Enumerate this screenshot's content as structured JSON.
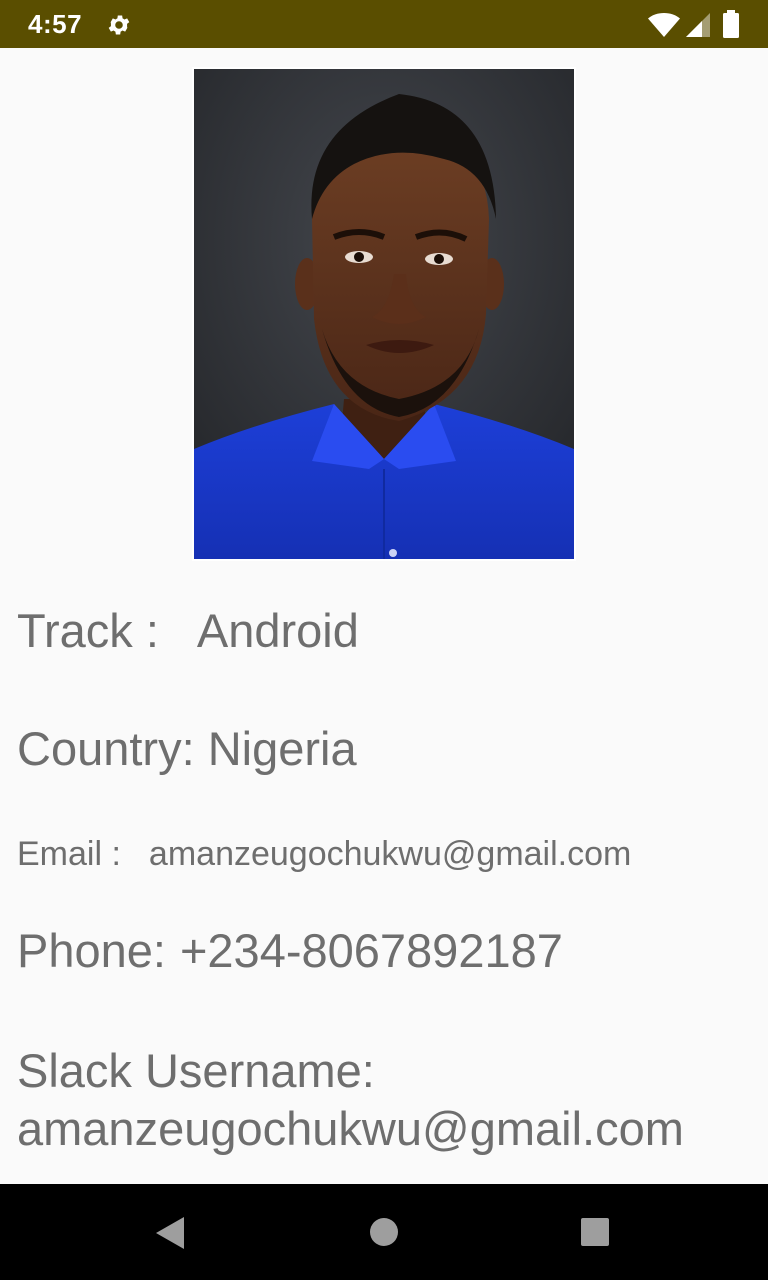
{
  "status_bar": {
    "time": "4:57",
    "icons": [
      "settings-gear-icon",
      "wifi-icon",
      "cell-signal-icon",
      "battery-icon"
    ],
    "background": "#5a4e00"
  },
  "profile": {
    "photo_description_icon": "profile-photo",
    "track_label": "Track :",
    "track_value": "Android",
    "country_label": "Country:",
    "country_value": "Nigeria",
    "email_label": "Email :",
    "email_value": "amanzeugochukwu@gmail.com",
    "phone_label": "Phone:",
    "phone_value": "+234-8067892187",
    "slack_label": "Slack Username:",
    "slack_value": "amanzeugochukwu@gmail.com",
    "text_color": "#6e6e6e"
  },
  "nav_bar": {
    "icons": [
      "back-icon",
      "home-icon",
      "recents-icon"
    ]
  }
}
